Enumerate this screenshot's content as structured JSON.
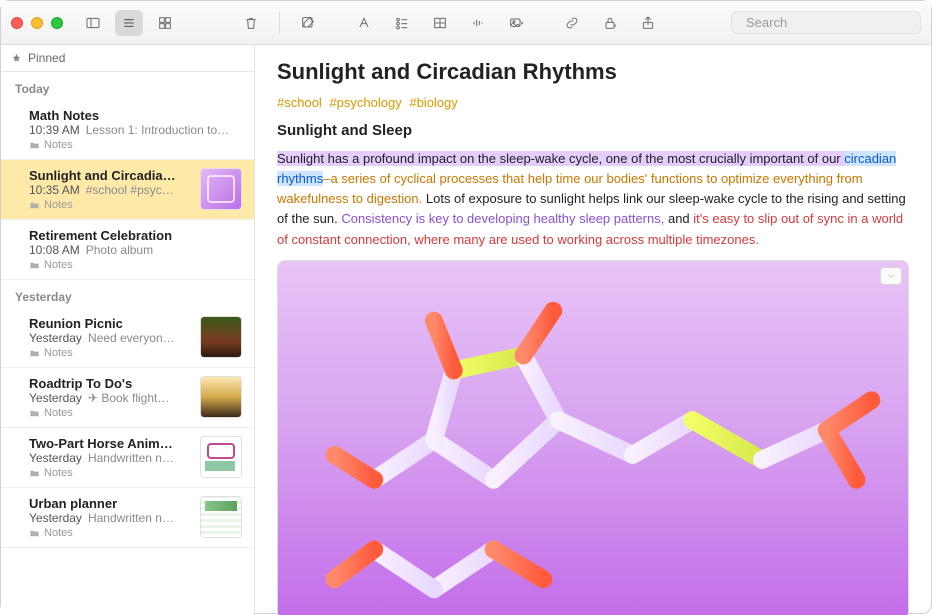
{
  "search": {
    "placeholder": "Search"
  },
  "sidebar": {
    "pinned_label": "Pinned",
    "sections": [
      {
        "label": "Today",
        "notes": [
          {
            "title": "Math Notes",
            "time": "10:39 AM",
            "preview": "Lesson 1: Introduction to…",
            "folder": "Notes",
            "thumb": null
          },
          {
            "title": "Sunlight and Circadia…",
            "time": "10:35 AM",
            "preview": "#school #psyc…",
            "folder": "Notes",
            "thumb": "mol",
            "selected": true
          },
          {
            "title": "Retirement Celebration",
            "time": "10:08 AM",
            "preview": "Photo album",
            "folder": "Notes",
            "thumb": null
          }
        ]
      },
      {
        "label": "Yesterday",
        "notes": [
          {
            "title": "Reunion Picnic",
            "time": "Yesterday",
            "preview": "Need everyon…",
            "folder": "Notes",
            "thumb": "picnic"
          },
          {
            "title": "Roadtrip To Do's",
            "time": "Yesterday",
            "preview": "✈︎ Book flight…",
            "folder": "Notes",
            "thumb": "biker"
          },
          {
            "title": "Two-Part Horse Anim…",
            "time": "Yesterday",
            "preview": "Handwritten n…",
            "folder": "Notes",
            "thumb": "doodle"
          },
          {
            "title": "Urban planner",
            "time": "Yesterday",
            "preview": "Handwritten n…",
            "folder": "Notes",
            "thumb": "plan"
          }
        ]
      }
    ]
  },
  "doc": {
    "title": "Sunlight and Circadian Rhythms",
    "tags": [
      "#school",
      "#psychology",
      "#biology"
    ],
    "subtitle": "Sunlight and Sleep",
    "p1_a": "Sunlight has a profound impact on the sleep-wake cycle, one of the most crucially important of our ",
    "p1_link": "circadian rhythms",
    "p1_b": "–a series of cyclical processes that help time our bodies' functions to optimize everything from wakefulness to digestion.",
    "p1_c": " Lots of exposure to sunlight helps link our sleep-wake cycle to the rising and setting of the sun. ",
    "p1_d": "Consistency is key to developing healthy sleep patterns,",
    "p1_e": " and ",
    "p1_f": "it's easy to slip out of sync in a world of constant connection, where many are used to working across multiple timezones."
  }
}
